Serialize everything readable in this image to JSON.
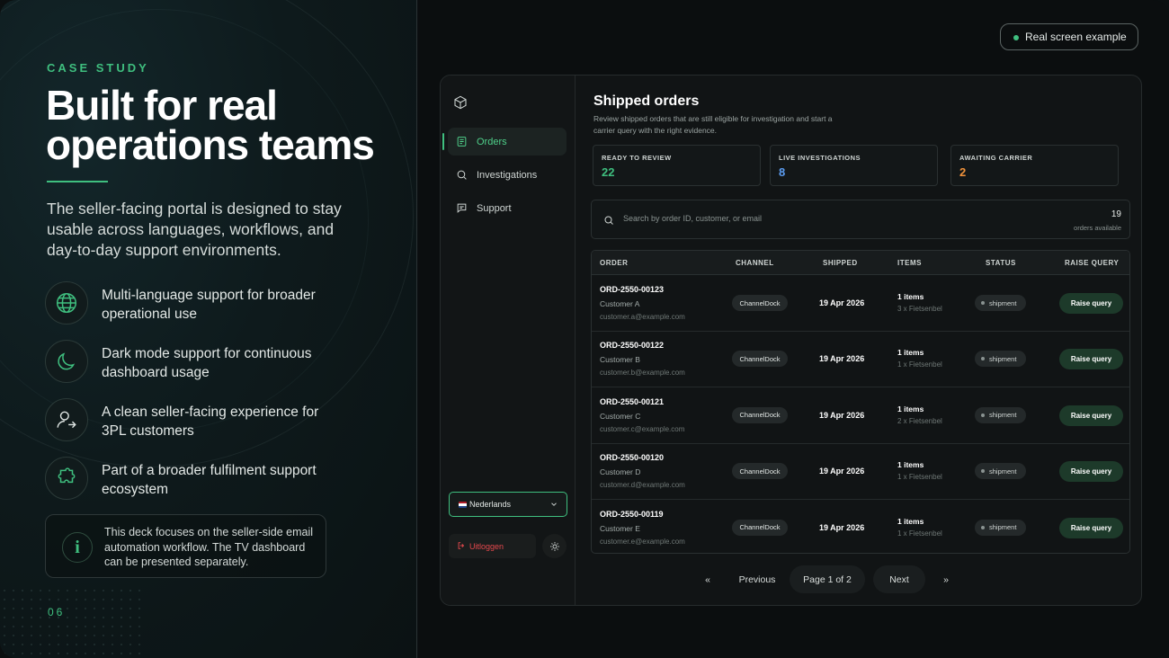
{
  "slide": {
    "eyebrow": "CASE STUDY",
    "headline": "Built for real operations teams",
    "lead": "The seller-facing portal is designed to stay usable across languages, workflows, and day-to-day support environments.",
    "features": [
      {
        "icon": "globe-icon",
        "text": "Multi-language support for broader operational use"
      },
      {
        "icon": "moon-icon",
        "text": "Dark mode support for continuous dashboard usage"
      },
      {
        "icon": "user-icon",
        "text": "A clean seller-facing experience for 3PL customers"
      },
      {
        "icon": "puzzle-icon",
        "text": "Part of a broader fulfilment support ecosystem"
      }
    ],
    "note": "This deck focuses on the seller-side email automation workflow. The TV dashboard can be presented separately.",
    "note_icon": "i",
    "page_number": "06",
    "badge": "Real screen example",
    "accent": "#3fbf7f"
  },
  "app": {
    "nav": [
      {
        "label": "Orders",
        "icon": "orders-icon",
        "active": true
      },
      {
        "label": "Investigations",
        "icon": "search-icon",
        "active": false
      },
      {
        "label": "Support",
        "icon": "chat-icon",
        "active": false
      }
    ],
    "language": "Nederlands",
    "logout": "Uitloggen",
    "title": "Shipped orders",
    "subtitle": "Review shipped orders that are still eligible for investigation and start a carrier query with the right evidence.",
    "stats": [
      {
        "label": "READY TO REVIEW",
        "value": "22",
        "color": "#3fbf7f"
      },
      {
        "label": "LIVE INVESTIGATIONS",
        "value": "8",
        "color": "#5b9cf0"
      },
      {
        "label": "AWAITING CARRIER",
        "value": "2",
        "color": "#f0923b"
      }
    ],
    "search": {
      "placeholder": "Search by order ID, customer, or email",
      "count": "19",
      "count_label": "orders available"
    },
    "columns": [
      "ORDER",
      "CHANNEL",
      "SHIPPED",
      "ITEMS",
      "STATUS",
      "RAISE QUERY"
    ],
    "rows": [
      {
        "order": "ORD-2550-00123",
        "customer": "Customer A",
        "email": "customer.a@example.com",
        "channel": "ChannelDock",
        "shipped": "19 Apr 2026",
        "items": "1 items",
        "item_detail": "3 x Fietsenbel",
        "status": "shipment",
        "action": "Raise query"
      },
      {
        "order": "ORD-2550-00122",
        "customer": "Customer B",
        "email": "customer.b@example.com",
        "channel": "ChannelDock",
        "shipped": "19 Apr 2026",
        "items": "1 items",
        "item_detail": "1 x Fietsenbel",
        "status": "shipment",
        "action": "Raise query"
      },
      {
        "order": "ORD-2550-00121",
        "customer": "Customer C",
        "email": "customer.c@example.com",
        "channel": "ChannelDock",
        "shipped": "19 Apr 2026",
        "items": "1 items",
        "item_detail": "2 x Fietsenbel",
        "status": "shipment",
        "action": "Raise query"
      },
      {
        "order": "ORD-2550-00120",
        "customer": "Customer D",
        "email": "customer.d@example.com",
        "channel": "ChannelDock",
        "shipped": "19 Apr 2026",
        "items": "1 items",
        "item_detail": "1 x Fietsenbel",
        "status": "shipment",
        "action": "Raise query"
      },
      {
        "order": "ORD-2550-00119",
        "customer": "Customer E",
        "email": "customer.e@example.com",
        "channel": "ChannelDock",
        "shipped": "19 Apr 2026",
        "items": "1 items",
        "item_detail": "1 x Fietsenbel",
        "status": "shipment",
        "action": "Raise query"
      }
    ],
    "pagination": {
      "first": "«",
      "previous": "Previous",
      "page": "Page 1 of 2",
      "next": "Next",
      "last": "»"
    }
  }
}
